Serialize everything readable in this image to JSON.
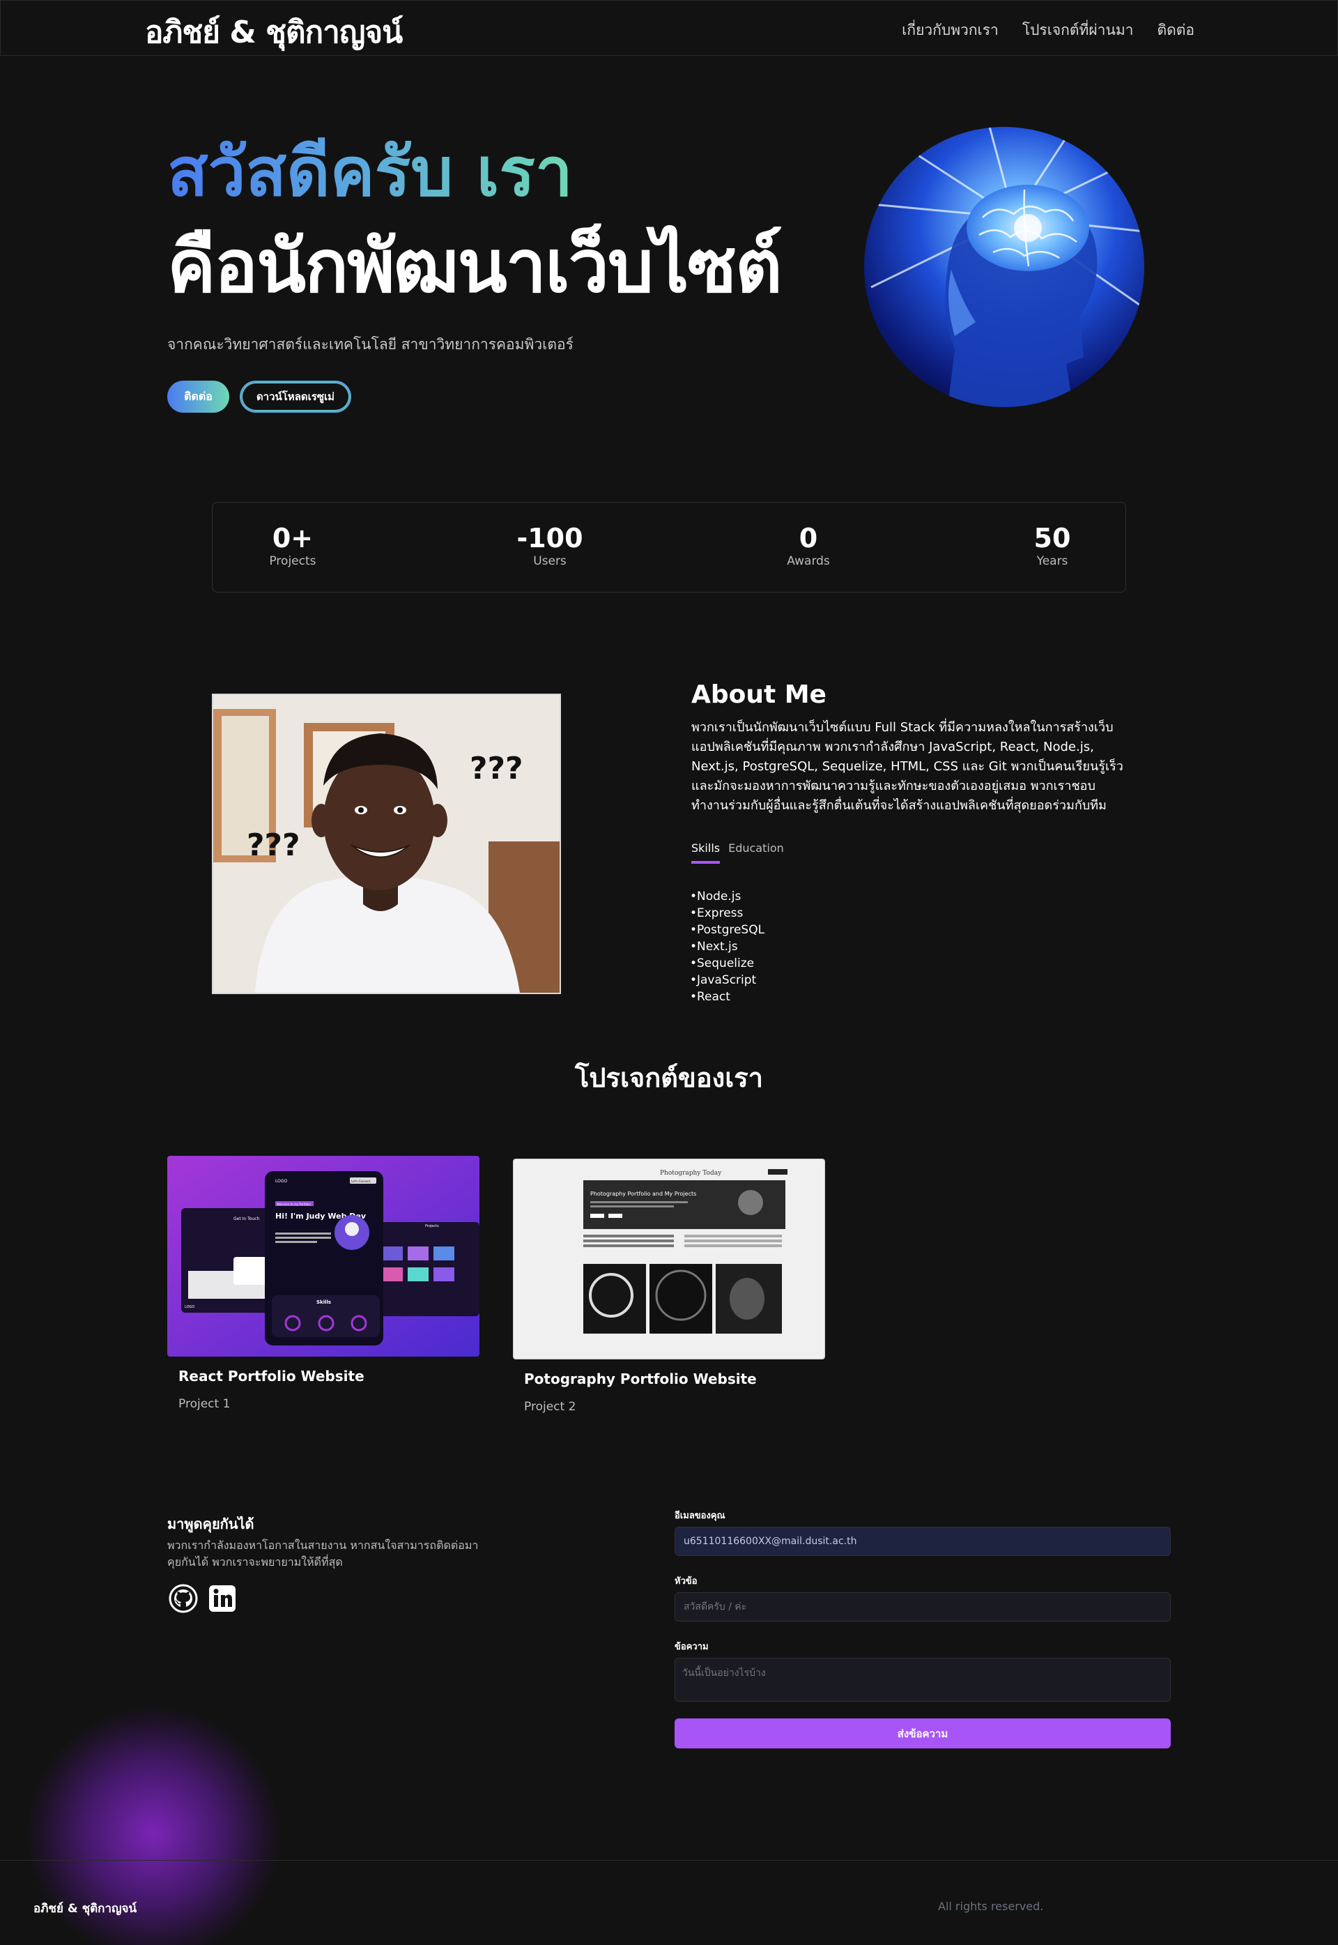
{
  "nav": {
    "brand": "อภิชย์ & ชุติกาญจน์",
    "links": [
      "เกี่ยวกับพวกเรา",
      "โปรเจกต์ที่ผ่านมา",
      "ติดต่อ"
    ]
  },
  "hero": {
    "greeting": "สวัสดีครับ เรา",
    "role": "คือนักพัฒนาเว็บไซต์",
    "subtitle": "จากคณะวิทยาศาสตร์และเทคโนโลยี สาขาวิทยาการคอมพิวเตอร์",
    "contact_button": "ติดต่อ",
    "resume_button": "ดาวน์โหลดเรซูเม่",
    "image_icon": "brain-head-icon"
  },
  "stats": [
    {
      "value": "0+",
      "label": "Projects"
    },
    {
      "value": "-100",
      "label": "Users"
    },
    {
      "value": "0",
      "label": "Awards"
    },
    {
      "value": "50",
      "label": "Years"
    }
  ],
  "about": {
    "title": "About Me",
    "text": "พวกเราเป็นนักพัฒนาเว็บไซต์แบบ Full Stack ที่มีความหลงใหลในการสร้างเว็บแอปพลิเคชันที่มีคุณภาพ พวกเรากำลังศึกษา JavaScript, React, Node.js, Next.js, PostgreSQL, Sequelize, HTML, CSS และ Git พวกเป็นคนเรียนรู้เร็วและมักจะมองหาการพัฒนาความรู้และทักษะของตัวเองอยู่เสมอ พวกเราชอบทำงานร่วมกับผู้อื่นและรู้สึกตื่นเต้นที่จะได้สร้างแอปพลิเคชันที่สุดยอดร่วมกับทีม",
    "tabs": [
      "Skills",
      "Education"
    ],
    "meme_text_1": "???",
    "meme_text_2": "???",
    "skills": [
      "Node.js",
      "Express",
      "PostgreSQL",
      "Next.js",
      "Sequelize",
      "JavaScript",
      "React"
    ]
  },
  "projects": {
    "title": "โปรเจกต์ของเรา",
    "items": [
      {
        "title": "React Portfolio Website",
        "subtitle": "Project 1",
        "thumb": {
          "logo": "LOGO",
          "welcome": "Welcome to my Portfolio",
          "headline": "Hi! I'm Judy Web Dev",
          "skills_heading": "Skills",
          "connect": "Let's Connect",
          "get_in_touch": "Get In Touch",
          "projects_heading": "Projects"
        }
      },
      {
        "title": "Potography Portfolio Website",
        "subtitle": "Project 2",
        "thumb": {
          "site_name": "Photography Today",
          "banner_title": "Photography Portfolio and My Projects"
        }
      }
    ]
  },
  "contact": {
    "title": "มาพูดคุยกันได้",
    "text": "พวกเรากำลังมองหาโอกาสในสายงาน หากสนใจสามารถติดต่อมาคุยกันได้ พวกเราจะพยายามให้ดีที่สุด",
    "socials": [
      "github-icon",
      "linkedin-icon"
    ],
    "email_label": "อีเมลของคุณ",
    "email_value": "u65110116600XX@mail.dusit.ac.th",
    "subject_label": "หัวข้อ",
    "subject_placeholder": "สวัสดีครับ / ค่ะ",
    "message_label": "ข้อความ",
    "message_placeholder": "วันนี้เป็นอย่างไรบ้าง",
    "submit": "ส่งข้อความ"
  },
  "footer": {
    "brand": "อภิชย์ & ชุติกาญจน์",
    "rights": "All rights reserved."
  },
  "colors": {
    "background": "#121212",
    "accent_purple": "#a855f7",
    "gradient_start": "#4a7cf0",
    "gradient_end": "#6fd8b4"
  }
}
